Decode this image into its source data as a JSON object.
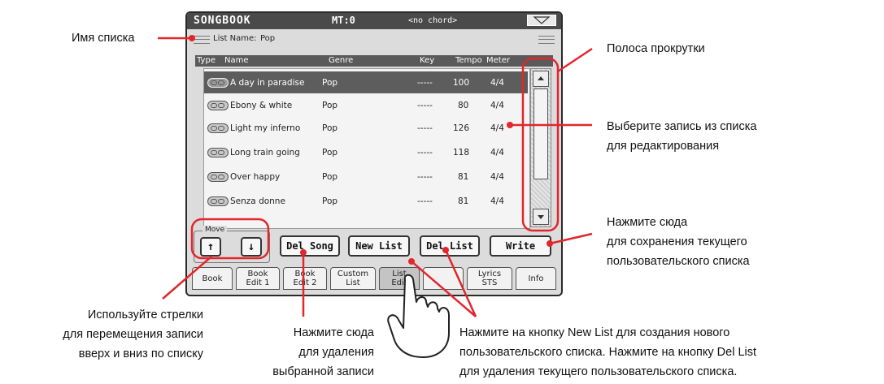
{
  "topbar": {
    "title": "SONGBOOK",
    "mt": "MT:0",
    "chord": "<no chord>"
  },
  "list_name": {
    "label": "List Name:",
    "value": "Pop"
  },
  "columns": {
    "type": "Type",
    "name": "Name",
    "genre": "Genre",
    "key": "Key",
    "tempo": "Tempo",
    "meter": "Meter"
  },
  "rows": [
    {
      "name": "A day in paradise",
      "genre": "Pop",
      "key": "-----",
      "tempo": "100",
      "meter": "4/4",
      "selected": true
    },
    {
      "name": "Ebony & white",
      "genre": "Pop",
      "key": "-----",
      "tempo": "80",
      "meter": "4/4"
    },
    {
      "name": "Light my inferno",
      "genre": "Pop",
      "key": "-----",
      "tempo": "126",
      "meter": "4/4"
    },
    {
      "name": "Long train going",
      "genre": "Pop",
      "key": "-----",
      "tempo": "118",
      "meter": "4/4"
    },
    {
      "name": "Over happy",
      "genre": "Pop",
      "key": "-----",
      "tempo": "81",
      "meter": "4/4"
    },
    {
      "name": "Senza donne",
      "genre": "Pop",
      "key": "-----",
      "tempo": "81",
      "meter": "4/4"
    }
  ],
  "buttons": {
    "move_label": "Move",
    "up": "↑",
    "down": "↓",
    "del_song": "Del Song",
    "new_list": "New List",
    "del_list": "Del List",
    "write": "Write"
  },
  "tabs": {
    "book": "Book",
    "book_edit_1": "Book\nEdit 1",
    "book_edit_2": "Book\nEdit 2",
    "custom_list": "Custom\nList",
    "list_edit": "List\nEdit",
    "lyrics_sts": "Lyrics\nSTS",
    "info": "Info"
  },
  "annotations": {
    "list_name": "Имя списка",
    "scrollbar": "Полоса прокрутки",
    "select_line1": "Выберите запись из списка",
    "select_line2": "для редактирования",
    "write_line1": "Нажмите сюда",
    "write_line2": "для сохранения текущего",
    "write_line3": "пользовательского списка",
    "arrows_line1": "Используйте стрелки",
    "arrows_line2": "для перемещения записи",
    "arrows_line3": "вверх и вниз по списку",
    "delsong_line1": "Нажмите сюда",
    "delsong_line2": "для удаления",
    "delsong_line3": "выбранной записи",
    "lists_line1": "Нажмите на кнопку New List для создания нового",
    "lists_line2": "пользовательского списка. Нажмите на кнопку Del List",
    "lists_line3": "для удаления текущего пользовательского списка."
  },
  "colors": {
    "accent": "#e3262b",
    "title_bar": "#4a4a4a",
    "selected_row": "#5d5d5d",
    "screen_bg": "#dcdcdc"
  }
}
